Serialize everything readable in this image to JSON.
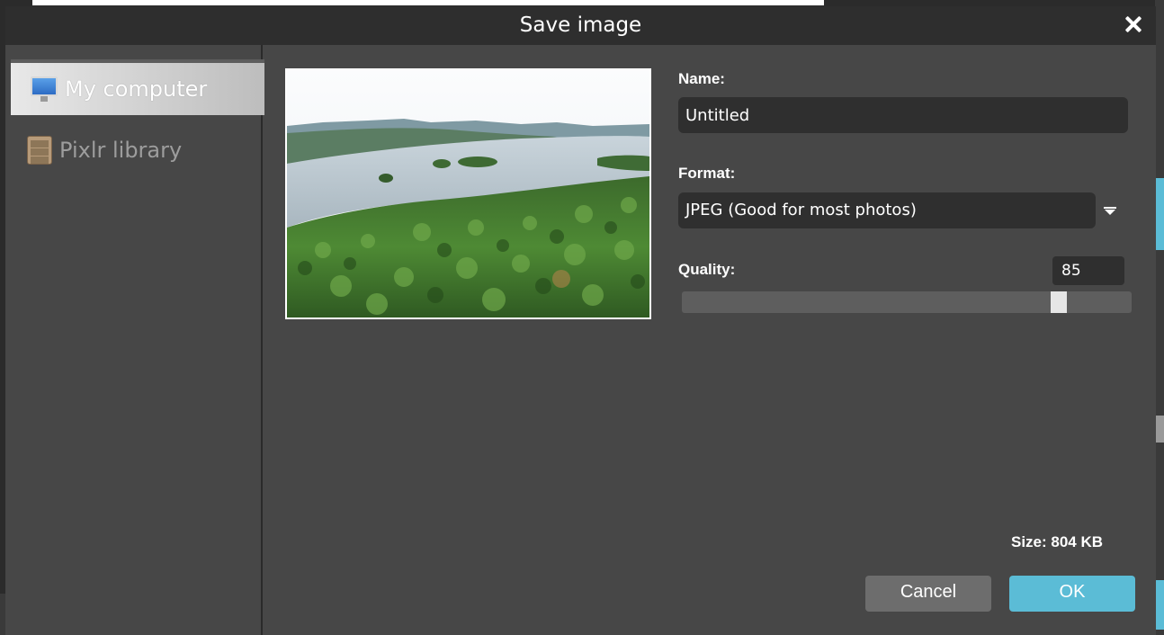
{
  "dialog": {
    "title": "Save image",
    "close_icon": "close-icon"
  },
  "sidebar": {
    "items": [
      {
        "label": "My computer",
        "icon": "monitor-icon",
        "active": true
      },
      {
        "label": "Pixlr library",
        "icon": "cabinet-icon",
        "active": false
      }
    ]
  },
  "preview": {
    "description_icon": "image-preview"
  },
  "form": {
    "name_label": "Name:",
    "name_value": "Untitled",
    "format_label": "Format:",
    "format_value": "JPEG (Good for most photos)",
    "quality_label": "Quality:",
    "quality_value": "85",
    "quality_level": 85
  },
  "footer": {
    "size_text": "Size: 804 KB",
    "cancel_label": "Cancel",
    "ok_label": "OK"
  },
  "colors": {
    "accent": "#5bbcd6",
    "dialog_bg": "#474747",
    "titlebar_bg": "#2e2e2e"
  }
}
